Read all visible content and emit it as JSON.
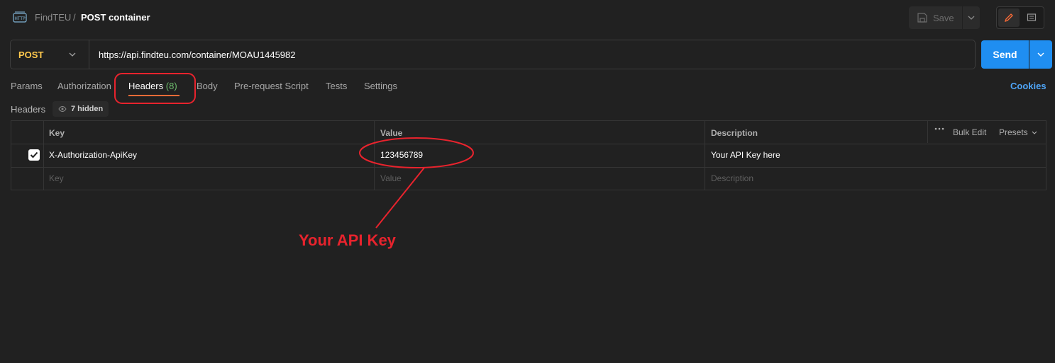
{
  "header": {
    "icon": "http-icon",
    "breadcrumb_parent": "FindTEU",
    "breadcrumb_separator": "/",
    "breadcrumb_current": "POST container",
    "save_label": "Save"
  },
  "request": {
    "method": "POST",
    "url": "https://api.findteu.com/container/MOAU1445982",
    "send_label": "Send"
  },
  "tabs": [
    {
      "label": "Params"
    },
    {
      "label": "Authorization"
    },
    {
      "label": "Headers",
      "count": "(8)",
      "active": true
    },
    {
      "label": "Body"
    },
    {
      "label": "Pre-request Script"
    },
    {
      "label": "Tests"
    },
    {
      "label": "Settings"
    }
  ],
  "cookies_label": "Cookies",
  "headers_section": {
    "label": "Headers",
    "hidden_label": "7 hidden"
  },
  "table": {
    "columns": {
      "key": "Key",
      "value": "Value",
      "description": "Description"
    },
    "bulk_edit": "Bulk Edit",
    "presets": "Presets",
    "rows": [
      {
        "checked": true,
        "key": "X-Authorization-ApiKey",
        "value": "123456789",
        "description": "Your API Key here"
      }
    ],
    "placeholder": {
      "key": "Key",
      "value": "Value",
      "description": "Description"
    }
  },
  "annotation": {
    "label": "Your API Key",
    "color": "#e8232d"
  },
  "colors": {
    "background": "#212121",
    "accent_blue": "#1f8ef1",
    "method_post": "#ffc94d",
    "active_tab_underline": "#ff6c37",
    "header_count": "#6dbd6d"
  }
}
